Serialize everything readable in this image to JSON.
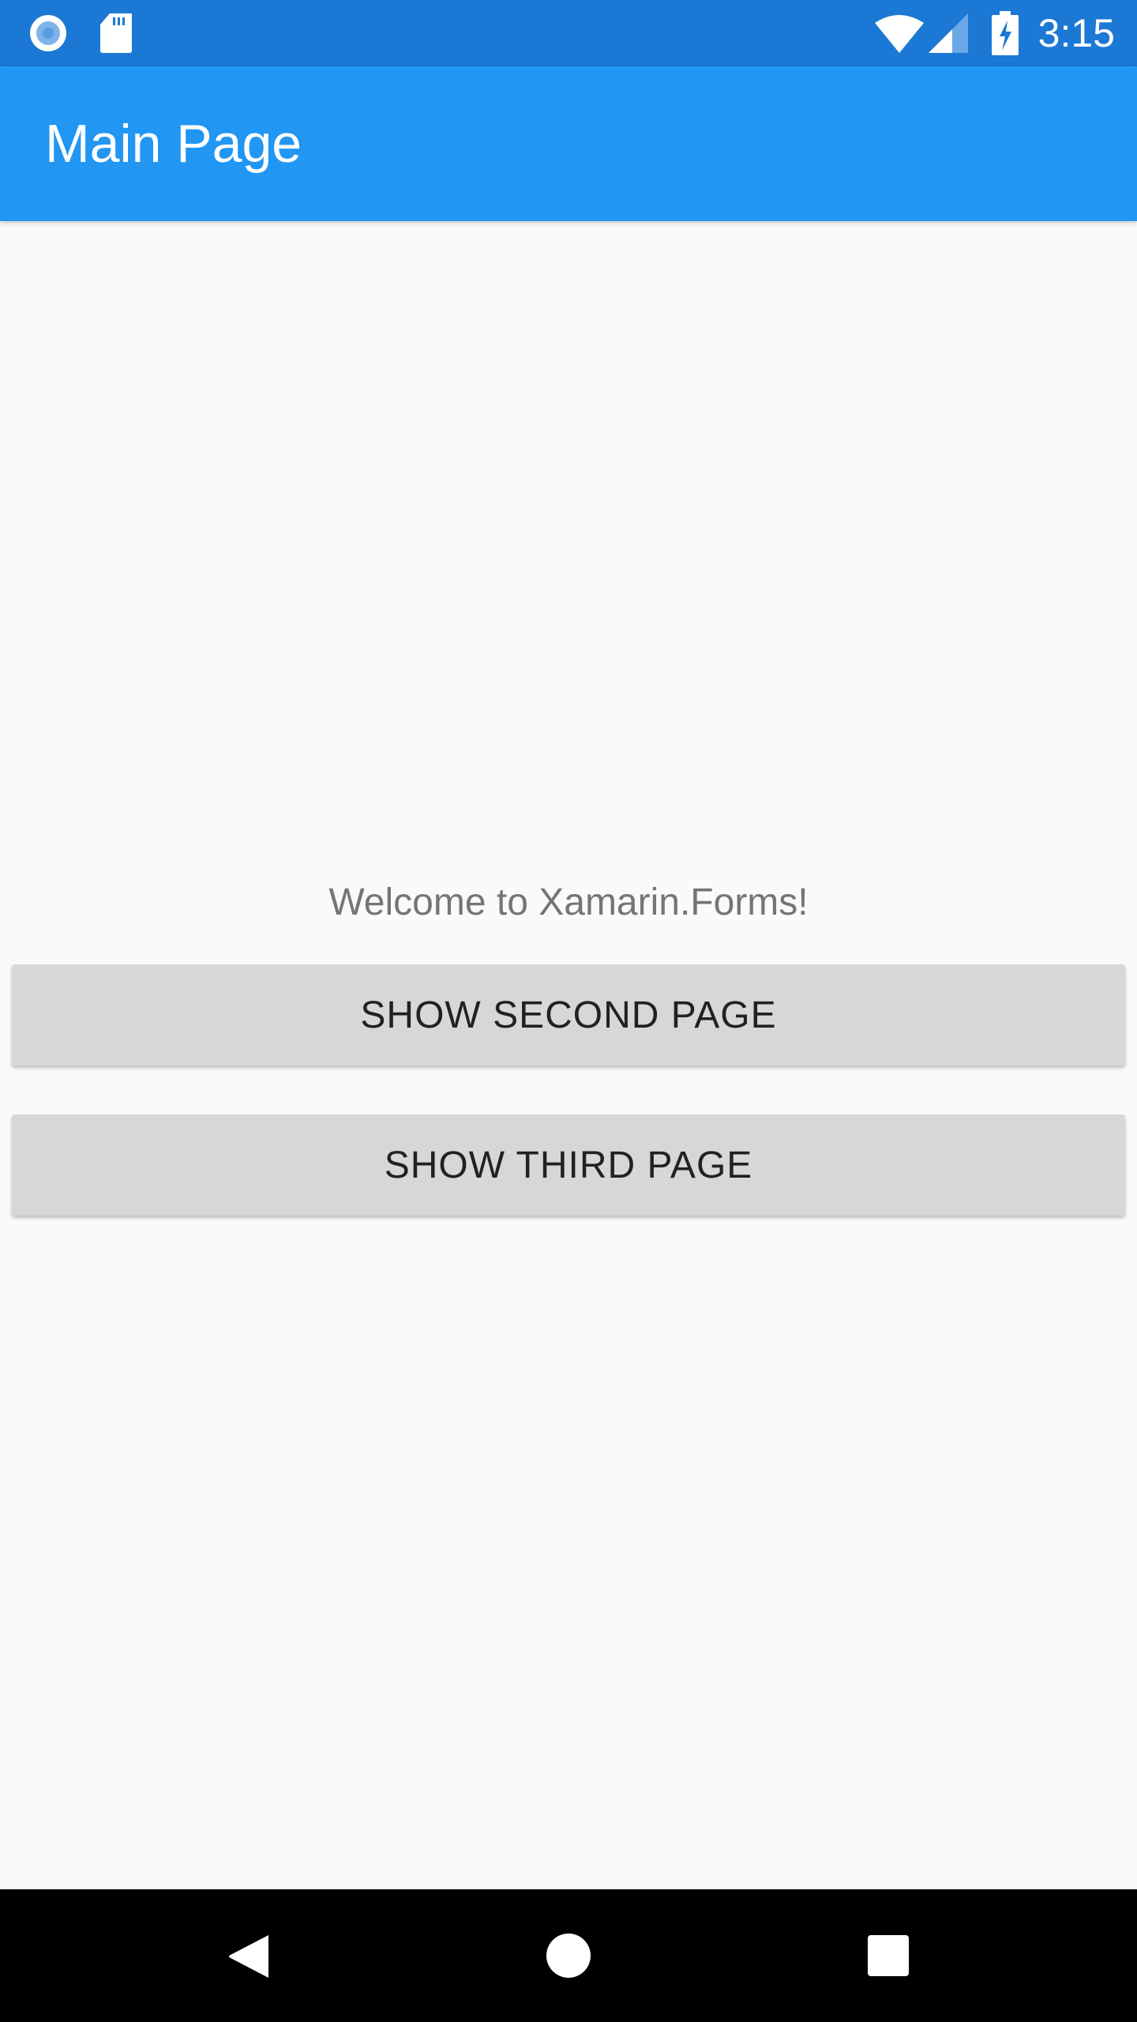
{
  "status_bar": {
    "time": "3:15",
    "icons": [
      "record-icon",
      "sd-card-icon",
      "wifi-icon",
      "signal-icon",
      "battery-charging-icon"
    ],
    "color": "#1b78d4"
  },
  "toolbar": {
    "title": "Main Page",
    "color": "#2196f3"
  },
  "main": {
    "welcome": "Welcome to Xamarin.Forms!",
    "buttons": [
      {
        "label": "SHOW SECOND PAGE"
      },
      {
        "label": "SHOW THIRD PAGE"
      }
    ]
  },
  "nav_bar": {
    "icons": [
      "back-icon",
      "home-icon",
      "recents-icon"
    ]
  }
}
